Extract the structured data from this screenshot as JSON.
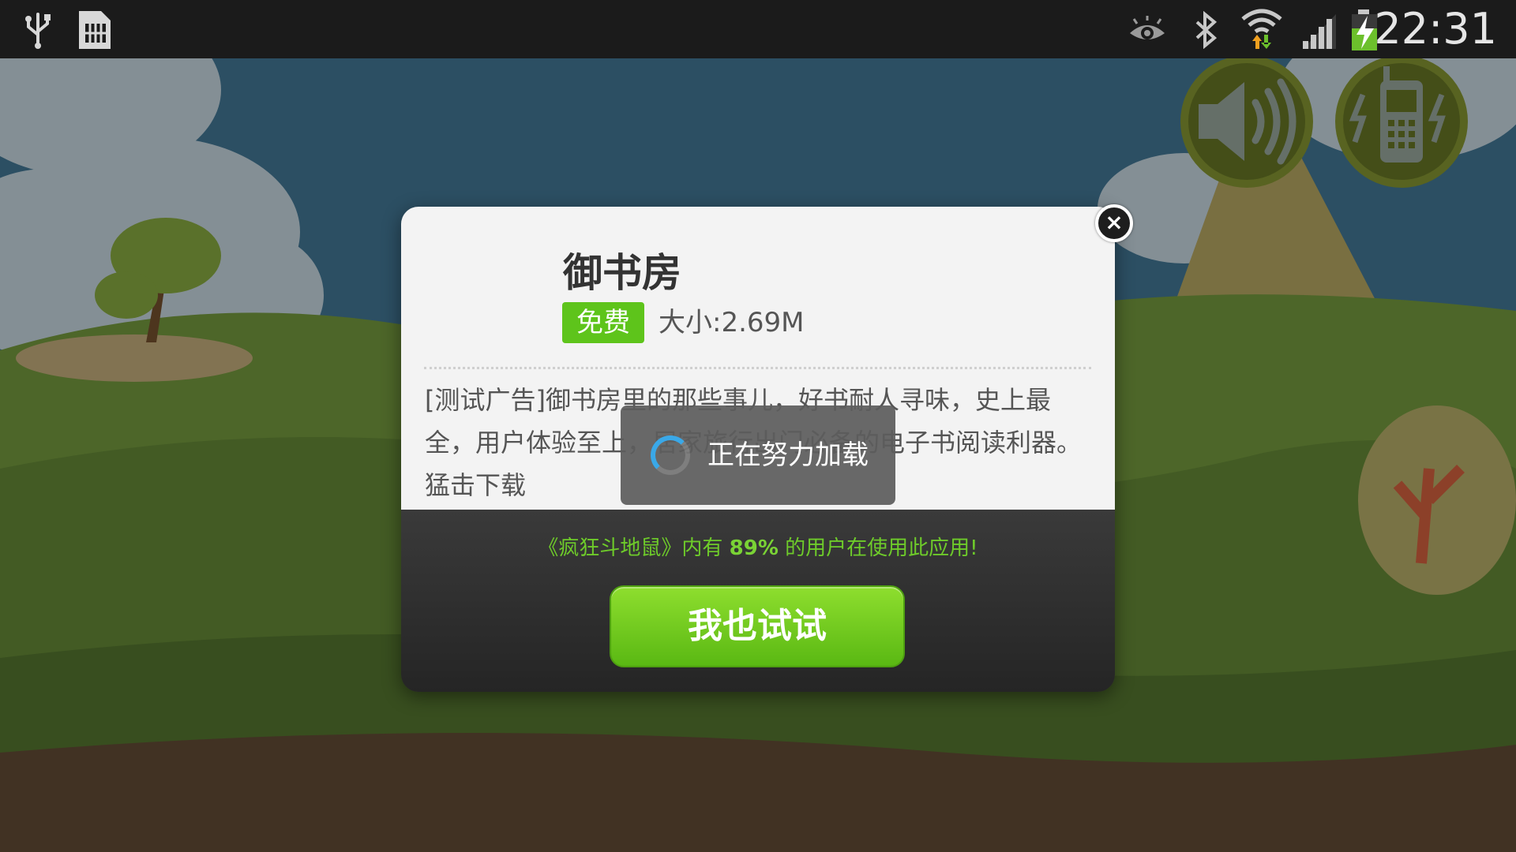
{
  "status_bar": {
    "time": "22:31",
    "icons": [
      "usb-icon",
      "sim-card-icon",
      "eye-icon",
      "bluetooth-icon",
      "wifi-icon",
      "signal-icon",
      "battery-charging-icon"
    ]
  },
  "game": {
    "buttons": [
      "sound-icon",
      "vibrate-phone-icon"
    ]
  },
  "dialog": {
    "app_name": "御书房",
    "price_badge": "免费",
    "size_text": "大小:2.69M",
    "description": "[测试广告]御书房里的那些事儿，好书耐人寻味，史上最全，用户体验至上，居家旅行出门必备的电子书阅读利器。猛击下载",
    "usage_prefix": "《疯狂斗地鼠》内有 ",
    "usage_percent": "89%",
    "usage_suffix": " 的用户在使用此应用!",
    "try_button": "我也试试",
    "close_symbol": "×"
  },
  "loading": {
    "text": "正在努力加载"
  },
  "colors": {
    "accent_green": "#5ec41b",
    "spinner_blue": "#3aa8e8",
    "status_bar_bg": "#1b1b1b"
  }
}
